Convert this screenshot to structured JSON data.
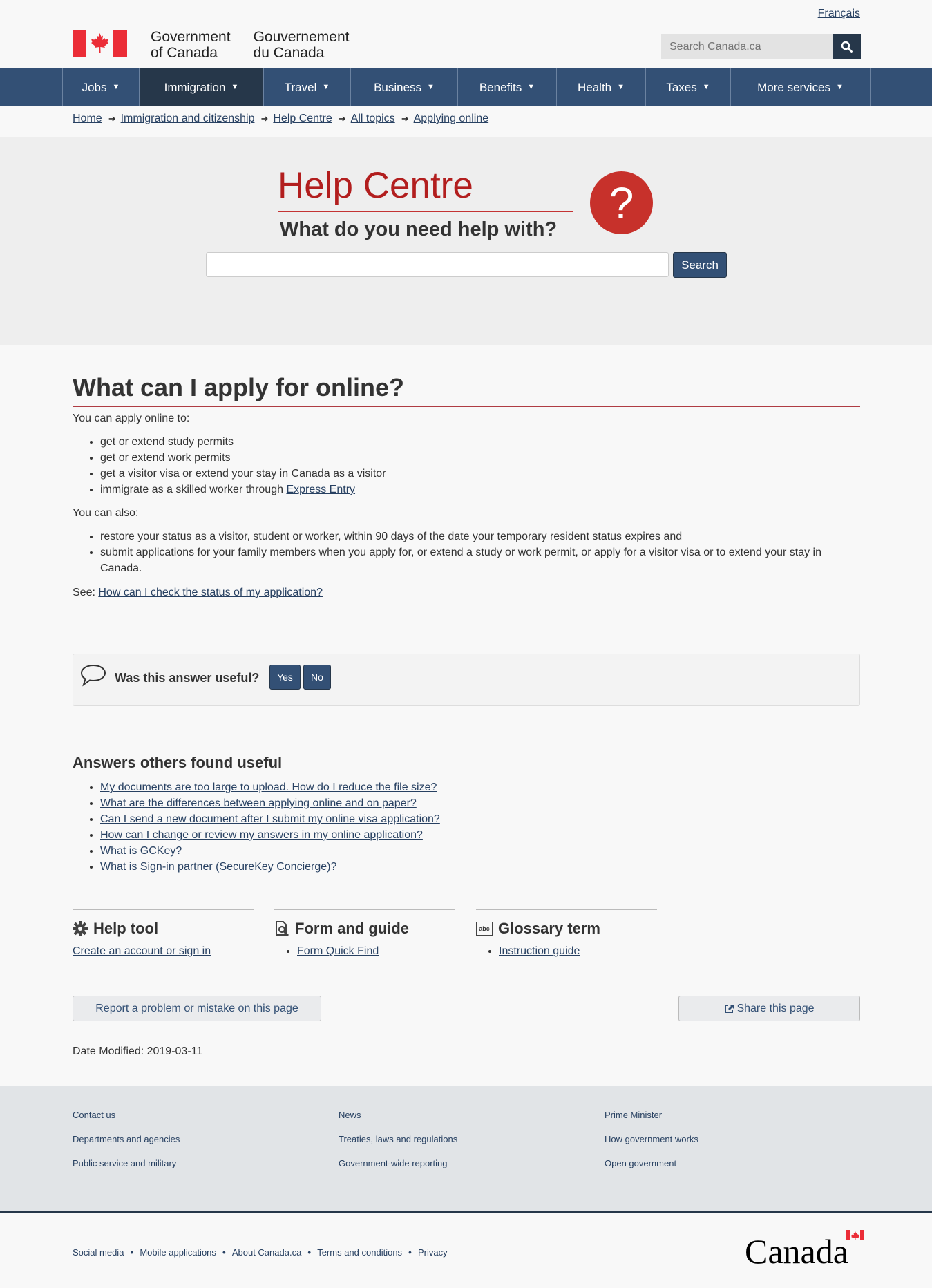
{
  "header": {
    "language_link": "Français",
    "sig_en_line1": "Government",
    "sig_en_line2": "of Canada",
    "sig_fr_line1": "Gouvernement",
    "sig_fr_line2": "du Canada",
    "search_placeholder": "Search Canada.ca",
    "search_icon": "search-icon"
  },
  "menu": {
    "items": [
      {
        "label": "Jobs"
      },
      {
        "label": "Immigration",
        "active": true
      },
      {
        "label": "Travel"
      },
      {
        "label": "Business"
      },
      {
        "label": "Benefits"
      },
      {
        "label": "Health"
      },
      {
        "label": "Taxes"
      },
      {
        "label": "More services"
      }
    ]
  },
  "breadcrumb": [
    "Home",
    "Immigration and citizenship",
    "Help Centre",
    "All topics",
    "Applying online"
  ],
  "hero": {
    "title": "Help Centre",
    "subtitle": "What do you need help with?",
    "question_mark": "?",
    "search_button": "Search"
  },
  "main": {
    "heading": "What can I apply for online?",
    "intro": "You can apply online to:",
    "apply_items": [
      "get or extend study permits",
      "get or extend work permits",
      "get a visitor visa or extend your stay in Canada as a visitor"
    ],
    "express_prefix": "immigrate as a skilled worker through ",
    "express_link": "Express Entry",
    "also_intro": "You can also:",
    "also_items": [
      "restore your status as a visitor, student or worker, within 90 days of the date your temporary resident status expires and",
      "submit applications for your family members when you apply for, or extend a study or work permit, or apply for a visitor visa or to extend your stay in Canada."
    ],
    "see_prefix": "See: ",
    "see_link": "How can I check the status of my application?"
  },
  "feedback": {
    "question": "Was this answer useful?",
    "yes": "Yes",
    "no": "No"
  },
  "others": {
    "heading": "Answers others found useful",
    "links": [
      "My documents are too large to upload. How do I reduce the file size?",
      "What are the differences between applying online and on paper?",
      "Can I send a new document after I submit my online visa application?",
      "How can I change or review my answers in my online application?",
      "What is GCKey?",
      "What is Sign-in partner (SecureKey Concierge)?"
    ]
  },
  "tools": {
    "help_tool": {
      "heading": "Help tool",
      "link": "Create an account or sign in"
    },
    "form_guide": {
      "heading": "Form and guide",
      "link": "Form Quick Find"
    },
    "glossary": {
      "heading": "Glossary term",
      "link": "Instruction guide",
      "icon_text": "abc"
    }
  },
  "page_actions": {
    "report": "Report a problem or mistake on this page",
    "share": "Share this page"
  },
  "date_modified": "Date Modified: 2019-03-11",
  "footer": {
    "col1": [
      "Contact us",
      "Departments and agencies",
      "Public service and military"
    ],
    "col2": [
      "News",
      "Treaties, laws and regulations",
      "Government-wide reporting"
    ],
    "col3": [
      "Prime Minister",
      "How government works",
      "Open government"
    ],
    "sub_links": [
      "Social media",
      "Mobile applications",
      "About Canada.ca",
      "Terms and conditions",
      "Privacy"
    ],
    "wordmark": "Canada"
  },
  "colors": {
    "nav_blue": "#335075",
    "dark_blue": "#26374a",
    "link": "#284162",
    "help_red": "#b21e1e",
    "flag_red": "#eb2d37"
  }
}
